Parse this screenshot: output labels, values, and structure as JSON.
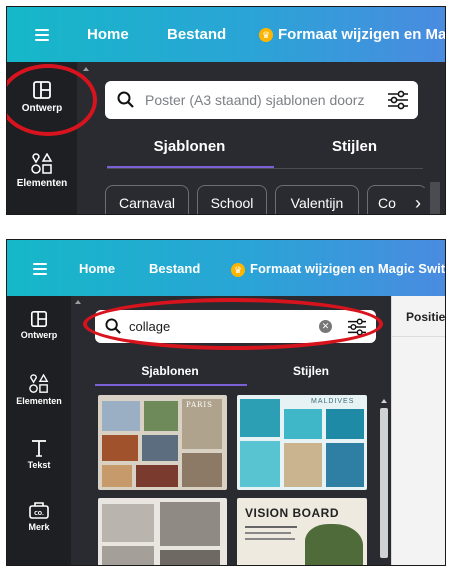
{
  "screen1": {
    "topbar": {
      "home": "Home",
      "bestand": "Bestand",
      "resize": "Formaat wijzigen en Magic"
    },
    "rail": {
      "design": "Ontwerp",
      "elements": "Elementen"
    },
    "search": {
      "placeholder": "Poster (A3 staand) sjablonen doorz"
    },
    "tabs": [
      "Sjablonen",
      "Stijlen"
    ],
    "chips": [
      "Carnaval",
      "School",
      "Valentijn",
      "Co"
    ]
  },
  "screen2": {
    "topbar": {
      "home": "Home",
      "bestand": "Bestand",
      "resize": "Formaat wijzigen en Magic Switch"
    },
    "rail": {
      "design": "Ontwerp",
      "elements": "Elementen",
      "text": "Tekst",
      "brand": "Merk"
    },
    "search": {
      "value": "collage"
    },
    "tabs": [
      "Sjablonen",
      "Stijlen"
    ],
    "position": "Positie",
    "thumbnails": {
      "paris": "PARIS",
      "maldives": "MALDIVES",
      "vision": "VISION BOARD"
    }
  },
  "colors": {
    "accent_red": "#d7141e",
    "topbar_start": "#15b8c8",
    "topbar_end": "#4a8be0",
    "panel_dark": "#2a2b30",
    "crown": "#ffb400"
  }
}
